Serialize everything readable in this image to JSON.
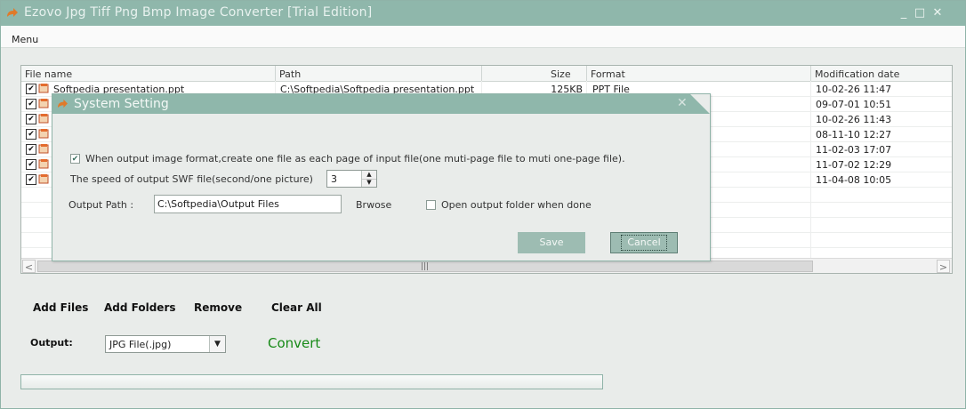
{
  "window": {
    "title": "Ezovo Jpg Tiff Png Bmp Image Converter [Trial Edition]",
    "controls": [
      "_",
      "□",
      "✕"
    ]
  },
  "menu": {
    "label": "Menu"
  },
  "grid": {
    "headers": {
      "name": "File name",
      "path": "Path",
      "size": "Size",
      "format": "Format",
      "modified": "Modification date"
    },
    "rows": [
      {
        "name": "Softpedia presentation.ppt",
        "path": "C:\\Softpedia\\Softpedia presentation.ppt",
        "size": "125KB",
        "format": "PPT File",
        "modified": "10-02-26 11:47"
      },
      {
        "name": "",
        "path": "",
        "size": "",
        "format": "",
        "modified": "09-07-01 10:51"
      },
      {
        "name": "",
        "path": "",
        "size": "",
        "format": "",
        "modified": "10-02-26 11:43"
      },
      {
        "name": "",
        "path": "",
        "size": "",
        "format": "",
        "modified": "08-11-10 12:27"
      },
      {
        "name": "",
        "path": "",
        "size": "",
        "format": "",
        "modified": "11-02-03 17:07"
      },
      {
        "name": "",
        "path": "",
        "size": "",
        "format": "",
        "modified": "11-07-02 12:29"
      },
      {
        "name": "",
        "path": "",
        "size": "",
        "format": "",
        "modified": "11-04-08 10:05"
      }
    ],
    "scroll_left": "<",
    "scroll_right": ">",
    "scroll_grip": "|||"
  },
  "actions": {
    "add_files": "Add Files",
    "add_folders": "Add Folders",
    "remove": "Remove",
    "clear_all": "Clear All"
  },
  "output": {
    "label": "Output:",
    "format": "JPG File(.jpg)",
    "convert": "Convert",
    "progress": 0
  },
  "dialog": {
    "title": "System Setting",
    "close": "✕",
    "one_file_per_page_checked": true,
    "one_file_per_page_label": "When output image format,create one file as each page of input file(one muti-page file to muti one-page file).",
    "swf_speed_label": "The speed of output SWF file(second/one picture)",
    "swf_speed_value": "3",
    "output_path_label": "Output Path :",
    "output_path_value": "C:\\Softpedia\\Output Files",
    "browse_label": "Brwose",
    "open_folder_checked": false,
    "open_folder_label": "Open output folder when done",
    "save_label": "Save",
    "cancel_label": "Cancel"
  },
  "colors": {
    "titlebar": "#8fb7ab",
    "convert_text": "#178a17",
    "button_bg": "#9dbcb2"
  }
}
